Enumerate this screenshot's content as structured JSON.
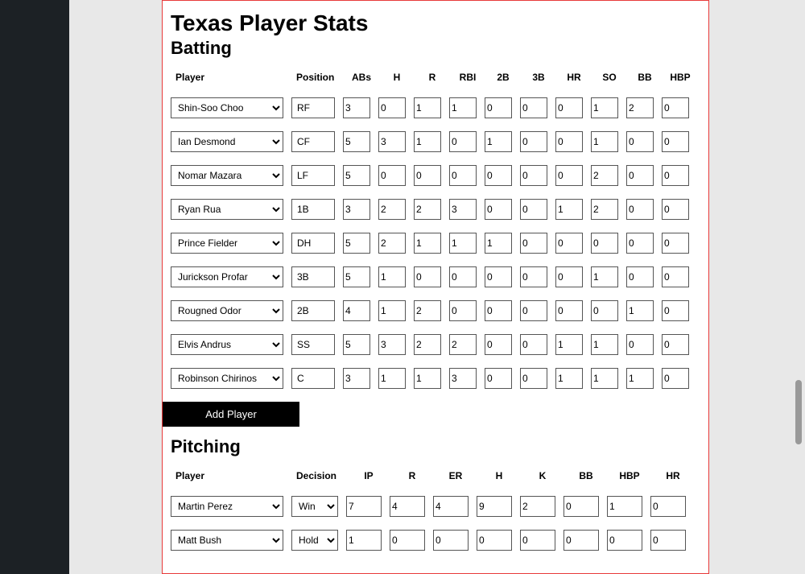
{
  "panel": {
    "title": "Texas Player Stats"
  },
  "batting": {
    "title": "Batting",
    "headers": {
      "player": "Player",
      "position": "Position",
      "abs": "ABs",
      "h": "H",
      "r": "R",
      "rbi": "RBI",
      "b2": "2B",
      "b3": "3B",
      "hr": "HR",
      "so": "SO",
      "bb": "BB",
      "hbp": "HBP"
    },
    "rows": [
      {
        "player": "Shin-Soo Choo",
        "position": "RF",
        "abs": "3",
        "h": "0",
        "r": "1",
        "rbi": "1",
        "b2": "0",
        "b3": "0",
        "hr": "0",
        "so": "1",
        "bb": "2",
        "hbp": "0"
      },
      {
        "player": "Ian Desmond",
        "position": "CF",
        "abs": "5",
        "h": "3",
        "r": "1",
        "rbi": "0",
        "b2": "1",
        "b3": "0",
        "hr": "0",
        "so": "1",
        "bb": "0",
        "hbp": "0"
      },
      {
        "player": "Nomar Mazara",
        "position": "LF",
        "abs": "5",
        "h": "0",
        "r": "0",
        "rbi": "0",
        "b2": "0",
        "b3": "0",
        "hr": "0",
        "so": "2",
        "bb": "0",
        "hbp": "0"
      },
      {
        "player": "Ryan Rua",
        "position": "1B",
        "abs": "3",
        "h": "2",
        "r": "2",
        "rbi": "3",
        "b2": "0",
        "b3": "0",
        "hr": "1",
        "so": "2",
        "bb": "0",
        "hbp": "0"
      },
      {
        "player": "Prince Fielder",
        "position": "DH",
        "abs": "5",
        "h": "2",
        "r": "1",
        "rbi": "1",
        "b2": "1",
        "b3": "0",
        "hr": "0",
        "so": "0",
        "bb": "0",
        "hbp": "0"
      },
      {
        "player": "Jurickson Profar",
        "position": "3B",
        "abs": "5",
        "h": "1",
        "r": "0",
        "rbi": "0",
        "b2": "0",
        "b3": "0",
        "hr": "0",
        "so": "1",
        "bb": "0",
        "hbp": "0"
      },
      {
        "player": "Rougned Odor",
        "position": "2B",
        "abs": "4",
        "h": "1",
        "r": "2",
        "rbi": "0",
        "b2": "0",
        "b3": "0",
        "hr": "0",
        "so": "0",
        "bb": "1",
        "hbp": "0"
      },
      {
        "player": "Elvis Andrus",
        "position": "SS",
        "abs": "5",
        "h": "3",
        "r": "2",
        "rbi": "2",
        "b2": "0",
        "b3": "0",
        "hr": "1",
        "so": "1",
        "bb": "0",
        "hbp": "0"
      },
      {
        "player": "Robinson Chirinos",
        "position": "C",
        "abs": "3",
        "h": "1",
        "r": "1",
        "rbi": "3",
        "b2": "0",
        "b3": "0",
        "hr": "1",
        "so": "1",
        "bb": "1",
        "hbp": "0"
      }
    ],
    "add_button": "Add Player"
  },
  "pitching": {
    "title": "Pitching",
    "headers": {
      "player": "Player",
      "decision": "Decision",
      "ip": "IP",
      "r": "R",
      "er": "ER",
      "h": "H",
      "k": "K",
      "bb": "BB",
      "hbp": "HBP",
      "hr": "HR"
    },
    "rows": [
      {
        "player": "Martin Perez",
        "decision": "Win",
        "ip": "7",
        "r": "4",
        "er": "4",
        "h": "9",
        "k": "2",
        "bb": "0",
        "hbp": "1",
        "hr": "0"
      },
      {
        "player": "Matt Bush",
        "decision": "Hold",
        "ip": "1",
        "r": "0",
        "er": "0",
        "h": "0",
        "k": "0",
        "bb": "0",
        "hbp": "0",
        "hr": "0"
      }
    ]
  }
}
